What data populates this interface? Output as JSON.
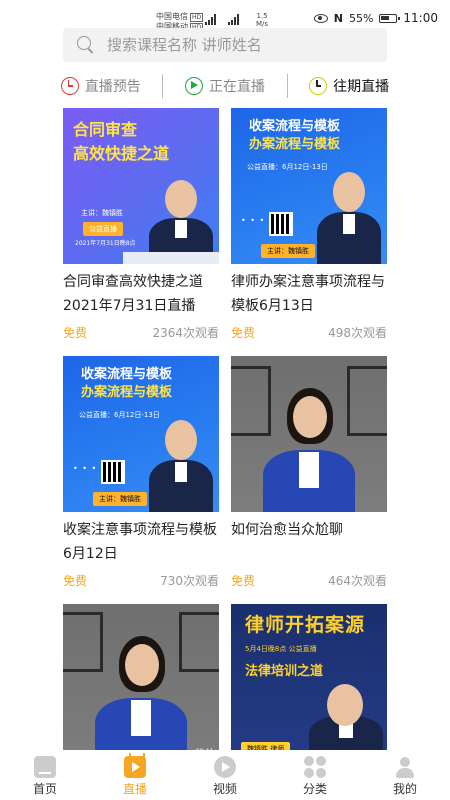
{
  "status_bar": {
    "carrier1": "中国电信",
    "carrier2": "中国移动",
    "hd": "HD",
    "network": "4G",
    "speed": "1.5",
    "speed_unit": "M/s",
    "battery": "55%",
    "time": "11:00"
  },
  "search": {
    "placeholder": "搜索课程名称 讲师姓名"
  },
  "tabs": [
    {
      "label": "直播预告"
    },
    {
      "label": "正在直播"
    },
    {
      "label": "往期直播"
    }
  ],
  "cards": [
    {
      "title": "合同审查高效快捷之道2021年7月31日直播",
      "price": "免费",
      "views": "2364次观看",
      "thumb": {
        "line1": "合同审查",
        "line2": "高效快捷之道",
        "lecturer": "主讲：魏镇胜",
        "tag": "公益直播",
        "date": "2021年7月31日晚8点"
      }
    },
    {
      "title": "律师办案注意事项流程与模板6月13日",
      "price": "免费",
      "views": "498次观看",
      "thumb": {
        "line1": "收案流程与模板",
        "line2": "办案流程与模板",
        "tag": "公益直播：6月12日-13日",
        "lecturer": "主讲：魏镇胜"
      }
    },
    {
      "title": "收案注意事项流程与模板6月12日",
      "price": "免费",
      "views": "730次观看",
      "thumb": {
        "line1": "收案流程与模板",
        "line2": "办案流程与模板",
        "tag": "公益直播：6月12日-13日",
        "lecturer": "主讲：魏镇胜"
      }
    },
    {
      "title": "如何治愈当众尬聊",
      "price": "免费",
      "views": "464次观看"
    },
    {
      "title": "",
      "price": "",
      "views": "",
      "thumb": {
        "time": "00:44"
      }
    },
    {
      "title": "",
      "price": "",
      "views": "",
      "thumb": {
        "line1": "律师开拓案源",
        "tag": "5月4日晚8点  公益直播",
        "line2": "法律培训之道",
        "lecturer": "魏镇胜 律师"
      }
    }
  ],
  "nav": [
    {
      "label": "首页",
      "icon": "home-icon"
    },
    {
      "label": "直播",
      "icon": "live-icon"
    },
    {
      "label": "视频",
      "icon": "video-icon"
    },
    {
      "label": "分类",
      "icon": "category-icon"
    },
    {
      "label": "我的",
      "icon": "profile-icon"
    }
  ],
  "colors": {
    "accent": "#f5a623",
    "live_green": "#22a843",
    "preview_red": "#e53935"
  }
}
